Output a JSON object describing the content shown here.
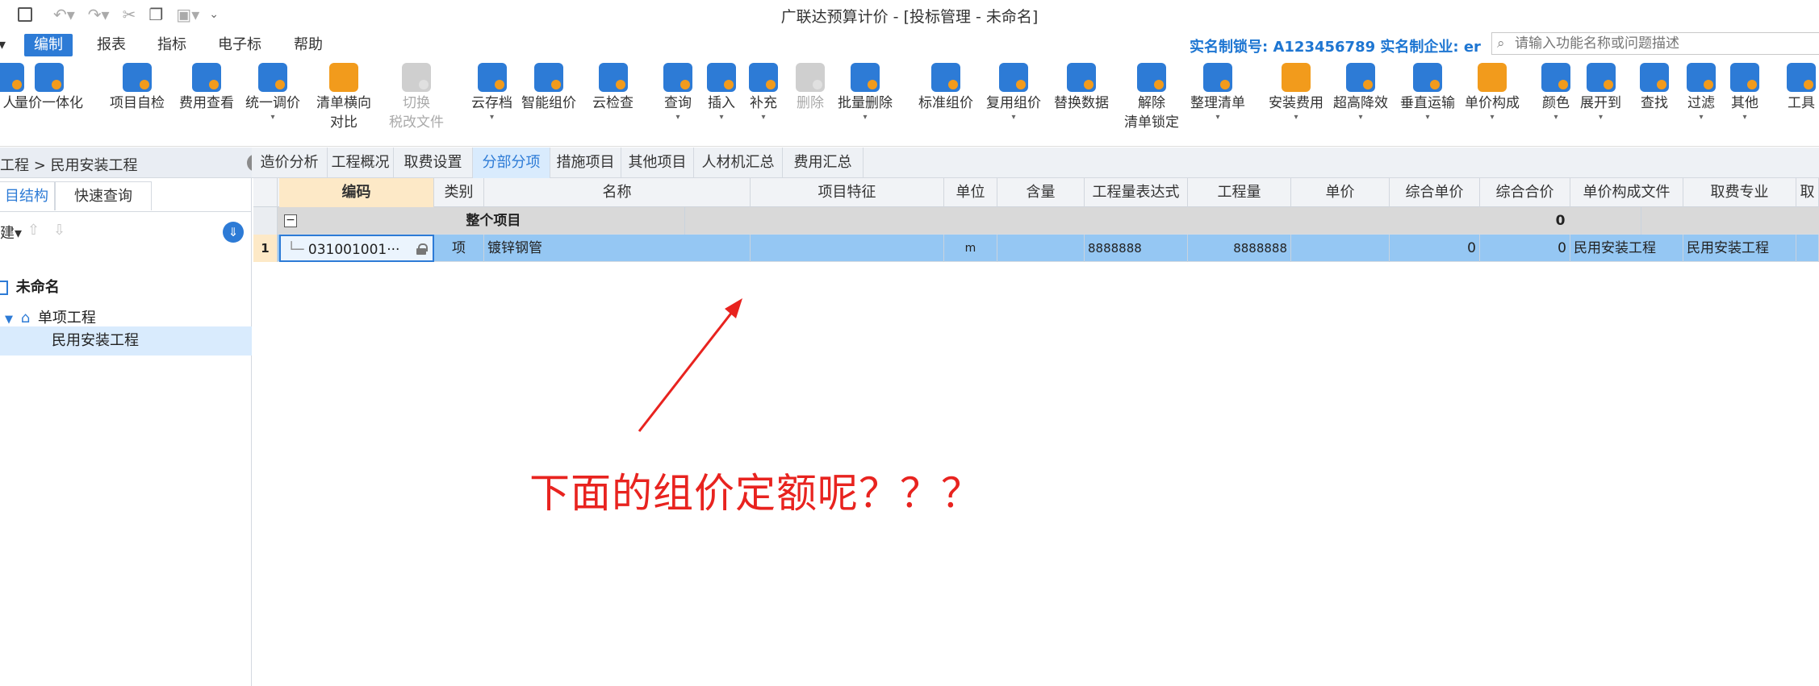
{
  "window": {
    "title": "广联达预算计价 - [投标管理 - 未命名]"
  },
  "menu": {
    "items": [
      {
        "label": "编制",
        "active": true
      },
      {
        "label": "报表"
      },
      {
        "label": "指标"
      },
      {
        "label": "电子标"
      },
      {
        "label": "帮助"
      }
    ],
    "realname": "实名制锁号: A123456789  实名制企业: er",
    "search_placeholder": "请输入功能名称或问题描述"
  },
  "ribbon": [
    {
      "label": "人",
      "color": "#2d7bd6"
    },
    {
      "label": "量价一体化",
      "color": "#2d7bd6"
    },
    {
      "label": "项目自检",
      "color": "#2d7bd6"
    },
    {
      "label": "费用查看",
      "color": "#2d7bd6"
    },
    {
      "label": "统一调价",
      "color": "#2d7bd6"
    },
    {
      "label": "清单横向",
      "label2": "对比",
      "color": "#2d7bd6"
    },
    {
      "label": "切换",
      "label2": "税改文件",
      "disabled": true
    },
    {
      "label": "云存档",
      "color": "#2d7bd6"
    },
    {
      "label": "智能组价",
      "color": "#2d7bd6"
    },
    {
      "label": "云检查",
      "color": "#2d7bd6"
    },
    {
      "label": "查询",
      "color": "#2d7bd6"
    },
    {
      "label": "插入",
      "color": "#2d7bd6"
    },
    {
      "label": "补充",
      "color": "#2d7bd6"
    },
    {
      "label": "删除",
      "disabled": true
    },
    {
      "label": "批量删除",
      "color": "#2d7bd6"
    },
    {
      "label": "标准组价",
      "color": "#2d7bd6"
    },
    {
      "label": "复用组价",
      "color": "#2d7bd6"
    },
    {
      "label": "替换数据",
      "color": "#2d7bd6"
    },
    {
      "label": "解除",
      "label2": "清单锁定",
      "color": "#2d7bd6"
    },
    {
      "label": "整理清单",
      "color": "#2d7bd6"
    },
    {
      "label": "安装费用",
      "color": "#2d7bd6"
    },
    {
      "label": "超高降效",
      "color": "#2d7bd6"
    },
    {
      "label": "垂直运输",
      "color": "#2d7bd6"
    },
    {
      "label": "单价构成",
      "color": "#2d7bd6"
    },
    {
      "label": "颜色",
      "color": "#2d7bd6"
    },
    {
      "label": "展开到",
      "color": "#2d7bd6"
    },
    {
      "label": "查找",
      "color": "#2d7bd6"
    },
    {
      "label": "过滤",
      "color": "#2d7bd6"
    },
    {
      "label": "其他",
      "color": "#2d7bd6"
    },
    {
      "label": "工具",
      "color": "#2d7bd6"
    }
  ],
  "breadcrumb": "工程 > 民用安装工程",
  "tabs": [
    "造价分析",
    "工程概况",
    "取费设置",
    "分部分项",
    "措施项目",
    "其他项目",
    "人材机汇总",
    "费用汇总"
  ],
  "active_tab": "分部分项",
  "left_panel": {
    "tabs": [
      "目结构",
      "快速查询"
    ],
    "toolbar_label": "建",
    "tree": [
      {
        "label": "未命名"
      },
      {
        "label": "单项工程"
      },
      {
        "label": "民用安装工程",
        "selected": true
      }
    ]
  },
  "grid": {
    "columns": [
      "编码",
      "类别",
      "名称",
      "项目特征",
      "单位",
      "含量",
      "工程量表达式",
      "工程量",
      "单价",
      "综合单价",
      "综合合价",
      "单价构成文件",
      "取费专业",
      "取"
    ],
    "total_row": {
      "name": "整个项目",
      "total": "0"
    },
    "rows": [
      {
        "num": "1",
        "code": "031001001···",
        "type": "项",
        "name": "镀锌钢管",
        "feature": "",
        "unit": "m",
        "content": "",
        "expr": "8888888",
        "qty": "8888888",
        "price": "",
        "unit_price": "0",
        "total": "0",
        "price_file": "民用安装工程",
        "fee_type": "民用安装工程"
      }
    ]
  },
  "annotation": {
    "text": "下面的组价定额呢？？？",
    "color": "#e8231f"
  }
}
